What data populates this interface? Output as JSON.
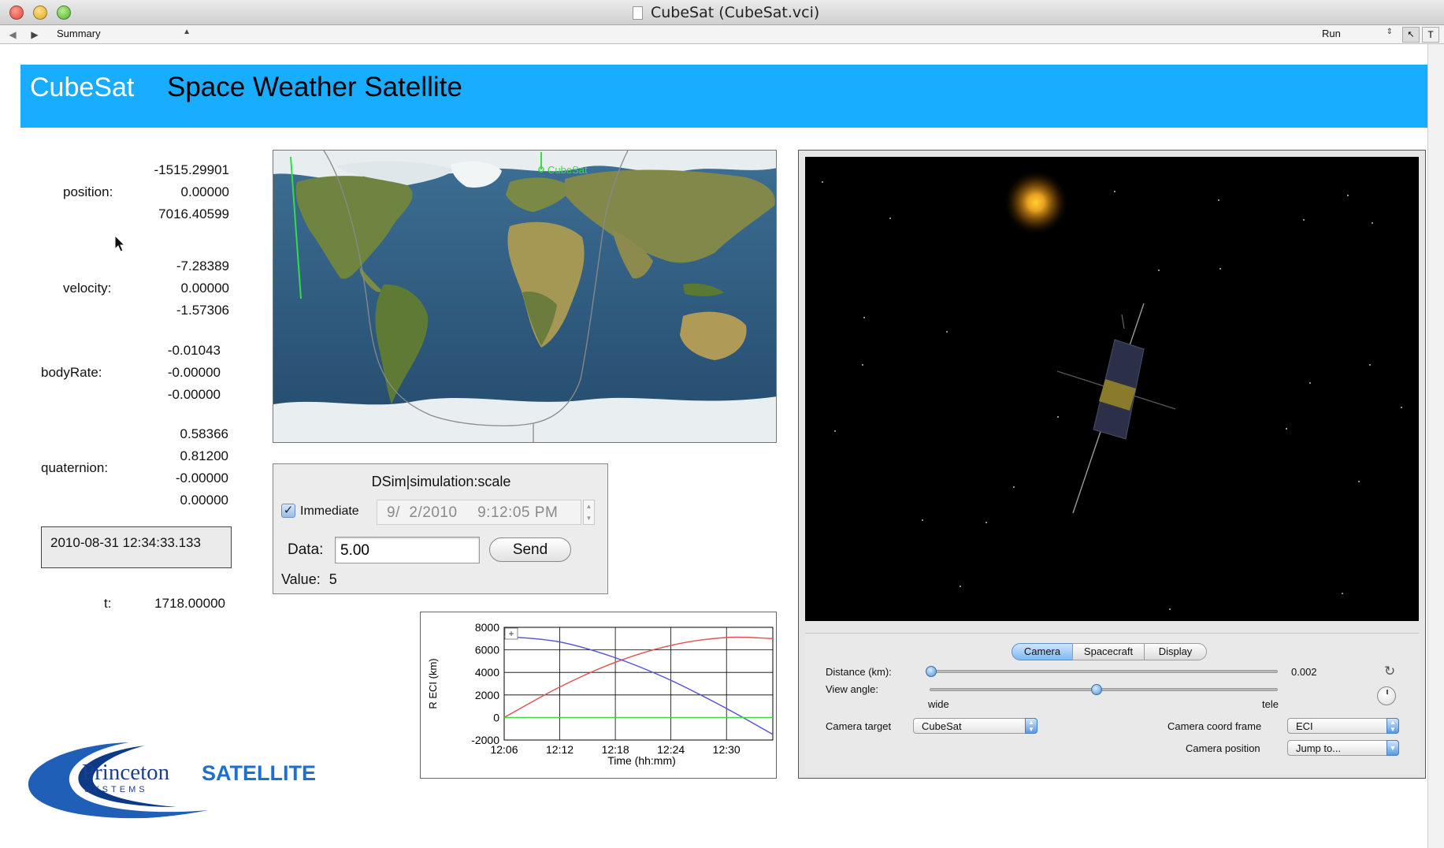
{
  "window": {
    "title": "CubeSat (CubeSat.vci)"
  },
  "toolbar": {
    "view": "Summary",
    "mode": "Run"
  },
  "header": {
    "brand": "CubeSat",
    "subtitle": "Space Weather Satellite"
  },
  "state": {
    "position_label": "position:",
    "position": [
      "-1515.29901",
      "0.00000",
      "7016.40599"
    ],
    "velocity_label": "velocity:",
    "velocity": [
      "-7.28389",
      "0.00000",
      "-1.57306"
    ],
    "bodyrate_label": "bodyRate:",
    "bodyrate": [
      "-0.01043",
      "-0.00000",
      "-0.00000"
    ],
    "quaternion_label": "quaternion:",
    "quaternion": [
      "0.58366",
      "0.81200",
      "-0.00000",
      "0.00000"
    ],
    "datetime": "2010-08-31 12:34:33.133",
    "t_label": "t:",
    "t": "1718.00000"
  },
  "map": {
    "satellite_label": "CubeSat",
    "colors": {
      "ocean": "#2f5f86",
      "land": "#5f7a3a",
      "ice": "#eef2f4",
      "track": "#8a8a8a",
      "marker": "#33dd44"
    }
  },
  "sim": {
    "title": "DSim|simulation:scale",
    "immediate_label": "Immediate",
    "immediate_checked": true,
    "date": "9/  2/2010",
    "time": "9:12:05 PM",
    "data_label": "Data:",
    "data_value": "5.00",
    "send_label": "Send",
    "value_label": "Value:",
    "value": "5"
  },
  "chart_data": {
    "type": "line",
    "ylabel": "R ECI (km)",
    "xlabel": "Time (hh:mm)",
    "x_ticks": [
      "12:06",
      "12:12",
      "12:18",
      "12:24",
      "12:30"
    ],
    "y_ticks": [
      "8000",
      "6000",
      "4000",
      "2000",
      "0",
      "-2000"
    ],
    "xlim": [
      "12:06",
      "12:35"
    ],
    "ylim": [
      -2000,
      8000
    ],
    "grid": true,
    "series": [
      {
        "color": "#e05050",
        "x": [
          "12:06",
          "12:12",
          "12:18",
          "12:24",
          "12:30",
          "12:35"
        ],
        "y": [
          0,
          2700,
          4900,
          6400,
          7100,
          7000
        ]
      },
      {
        "color": "#5050d8",
        "x": [
          "12:06",
          "12:12",
          "12:18",
          "12:24",
          "12:30",
          "12:35"
        ],
        "y": [
          7200,
          6700,
          5300,
          3300,
          800,
          -1500
        ]
      },
      {
        "color": "#40d840",
        "x": [
          "12:06",
          "12:35"
        ],
        "y": [
          0,
          0
        ]
      }
    ]
  },
  "viewer": {
    "tabs": [
      "Camera",
      "Spacecraft",
      "Display"
    ],
    "active_tab": "Camera",
    "distance_label": "Distance (km):",
    "distance_value": "0.002",
    "distance_level": 0.0,
    "view_angle_label": "View angle:",
    "view_angle_level": 0.48,
    "wide_label": "wide",
    "tele_label": "tele",
    "camera_target_label": "Camera target",
    "camera_target_value": "CubeSat",
    "coord_frame_label": "Camera coord frame",
    "coord_frame_value": "ECI",
    "camera_position_label": "Camera position",
    "camera_position_value": "Jump to..."
  },
  "logo": {
    "line1": "Princeton",
    "line2": "SATELLITE",
    "line3": "SYSTEMS"
  }
}
